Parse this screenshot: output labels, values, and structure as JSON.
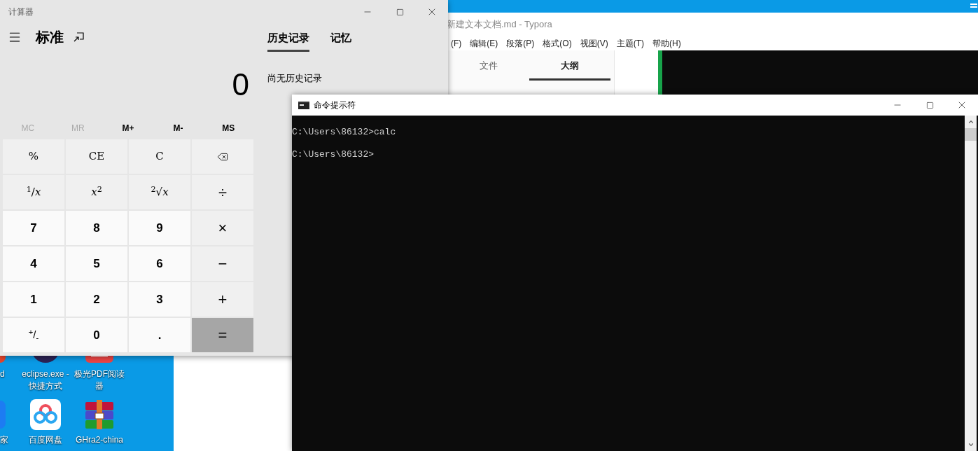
{
  "desktop": {
    "icons": [
      {
        "kind": "red-app",
        "label": "d"
      },
      {
        "kind": "eclipse",
        "label": "eclipse.exe - 快捷方式"
      },
      {
        "kind": "pdf",
        "label": "极光PDF阅读器"
      },
      {
        "kind": "shield",
        "label": "家"
      },
      {
        "kind": "cloud",
        "label": "百度网盘"
      },
      {
        "kind": "archive",
        "label": "GHra2-china"
      }
    ]
  },
  "typora": {
    "title": "新建文本文档.md - Typora",
    "menu": [
      "(F)",
      "编辑(E)",
      "段落(P)",
      "格式(O)",
      "视图(V)",
      "主题(T)",
      "帮助(H)"
    ],
    "sidebar_tabs": [
      {
        "label": "文件",
        "selected": false
      },
      {
        "label": "大纲",
        "selected": true
      }
    ]
  },
  "calculator": {
    "title": "计算器",
    "mode": "标准",
    "panel_tabs": [
      {
        "label": "历史记录",
        "selected": true
      },
      {
        "label": "记忆",
        "selected": false
      }
    ],
    "history_message": "尚无历史记录",
    "display": "0",
    "memory": [
      {
        "label": "MC",
        "disabled": true
      },
      {
        "label": "MR",
        "disabled": true
      },
      {
        "label": "M+",
        "disabled": false
      },
      {
        "label": "M-",
        "disabled": false
      },
      {
        "label": "MS",
        "disabled": false
      }
    ],
    "keys": [
      {
        "kind": "function",
        "label": "%"
      },
      {
        "kind": "function",
        "label": "CE"
      },
      {
        "kind": "function",
        "label": "C"
      },
      {
        "kind": "backspace"
      },
      {
        "kind": "function",
        "label": "$^{1}$/*x*"
      },
      {
        "kind": "function",
        "label": "*x*$^{2}$"
      },
      {
        "kind": "function",
        "label": "$^{2}$√*x*"
      },
      {
        "kind": "operator",
        "label": "÷"
      },
      {
        "kind": "digit",
        "label": "7"
      },
      {
        "kind": "digit",
        "label": "8"
      },
      {
        "kind": "digit",
        "label": "9"
      },
      {
        "kind": "operator",
        "label": "×"
      },
      {
        "kind": "digit",
        "label": "4"
      },
      {
        "kind": "digit",
        "label": "5"
      },
      {
        "kind": "digit",
        "label": "6"
      },
      {
        "kind": "operator",
        "label": "−"
      },
      {
        "kind": "digit",
        "label": "1"
      },
      {
        "kind": "digit",
        "label": "2"
      },
      {
        "kind": "digit",
        "label": "3"
      },
      {
        "kind": "operator",
        "label": "+"
      },
      {
        "kind": "sign",
        "label": "$^{+}$/$_{-}$"
      },
      {
        "kind": "digit",
        "label": "0"
      },
      {
        "kind": "digit",
        "label": "."
      },
      {
        "kind": "equals",
        "label": "="
      }
    ]
  },
  "cmd": {
    "title": "命令提示符",
    "lines": [
      "C:\\Users\\86132>calc",
      "C:\\Users\\86132>"
    ]
  }
}
